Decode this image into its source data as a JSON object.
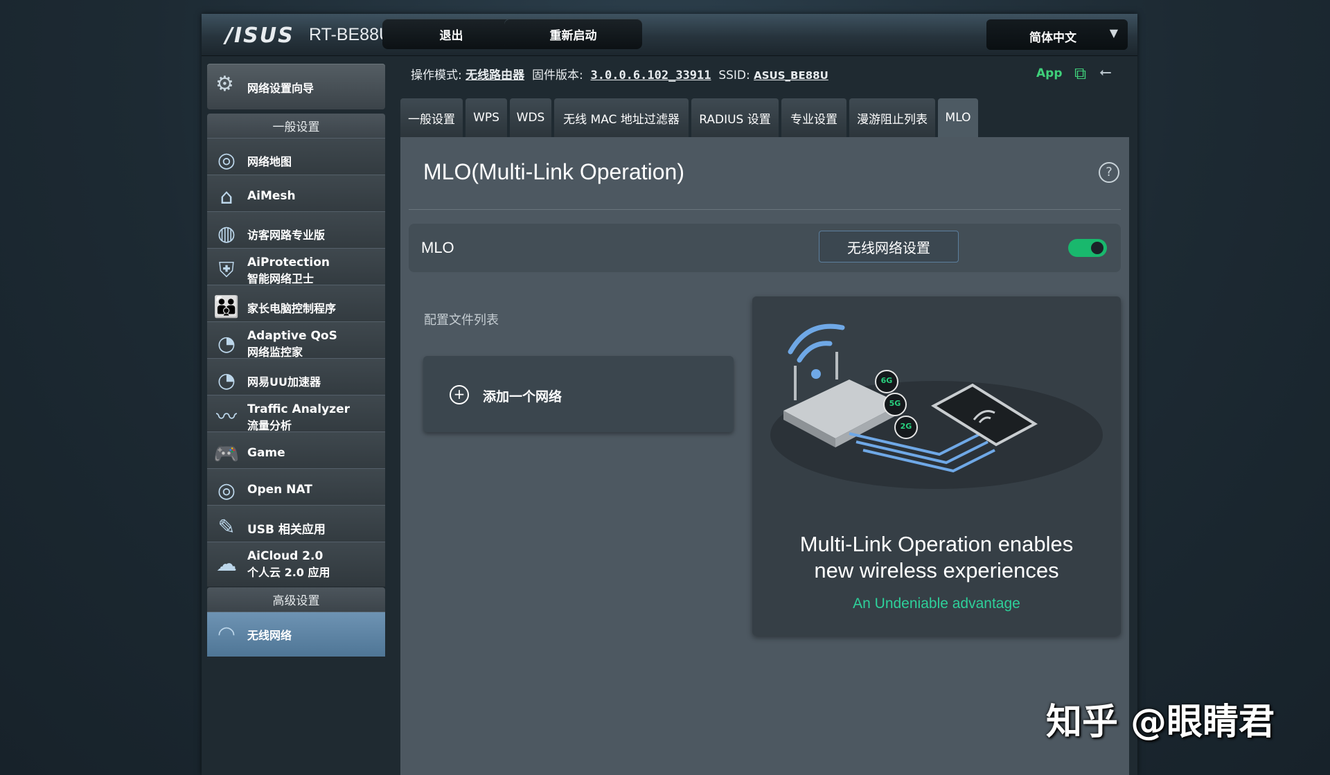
{
  "header": {
    "logo": "/ISUS",
    "model": "RT-BE88U",
    "logout_label": "退出",
    "reboot_label": "重新启动",
    "language": "简体中文"
  },
  "status": {
    "mode_label": "操作模式:",
    "mode_value": "无线路由器",
    "firmware_label": "固件版本:",
    "firmware_value": "3.0.0.6.102_33911",
    "ssid_label": "SSID:",
    "ssid_value": "ASUS_BE88U",
    "app_label": "App"
  },
  "sidebar": {
    "qis_label": "网络设置向导",
    "general_header": "一般设置",
    "items": [
      {
        "line1": "网络地图",
        "line2": ""
      },
      {
        "line1": "AiMesh",
        "line2": ""
      },
      {
        "line1": "访客网路专业版",
        "line2": ""
      },
      {
        "line1": "AiProtection",
        "line2": "智能网络卫士"
      },
      {
        "line1": "家长电脑控制程序",
        "line2": ""
      },
      {
        "line1": "Adaptive QoS",
        "line2": "网络监控家"
      },
      {
        "line1": "网易UU加速器",
        "line2": ""
      },
      {
        "line1": "Traffic Analyzer",
        "line2": "流量分析"
      },
      {
        "line1": "Game",
        "line2": ""
      },
      {
        "line1": "Open NAT",
        "line2": ""
      },
      {
        "line1": "USB 相关应用",
        "line2": ""
      },
      {
        "line1": "AiCloud 2.0",
        "line2": "个人云 2.0 应用"
      }
    ],
    "advanced_header": "高级设置",
    "advanced_items": [
      {
        "line1": "无线网络"
      }
    ]
  },
  "tabs": [
    "一般设置",
    "WPS",
    "WDS",
    "无线 MAC 地址过滤器",
    "RADIUS 设置",
    "专业设置",
    "漫游阻止列表",
    "MLO"
  ],
  "content": {
    "title": "MLO(Multi-Link Operation)",
    "help_icon": "?",
    "mlo_label": "MLO",
    "wireless_settings_button": "无线网络设置",
    "mlo_enabled": true,
    "profile_list_label": "配置文件列表",
    "add_network_label": "添加一个网络",
    "promo_title_1": "Multi-Link Operation enables",
    "promo_title_2": "new wireless experiences",
    "promo_subtitle": "An Undeniable advantage",
    "band_labels": [
      "6G",
      "5G",
      "2G"
    ]
  },
  "watermark": "知乎 @眼睛君",
  "colors": {
    "accent_green": "#19b86d",
    "subtitle_teal": "#2ed09a",
    "active_menu": "#5f86a8"
  }
}
